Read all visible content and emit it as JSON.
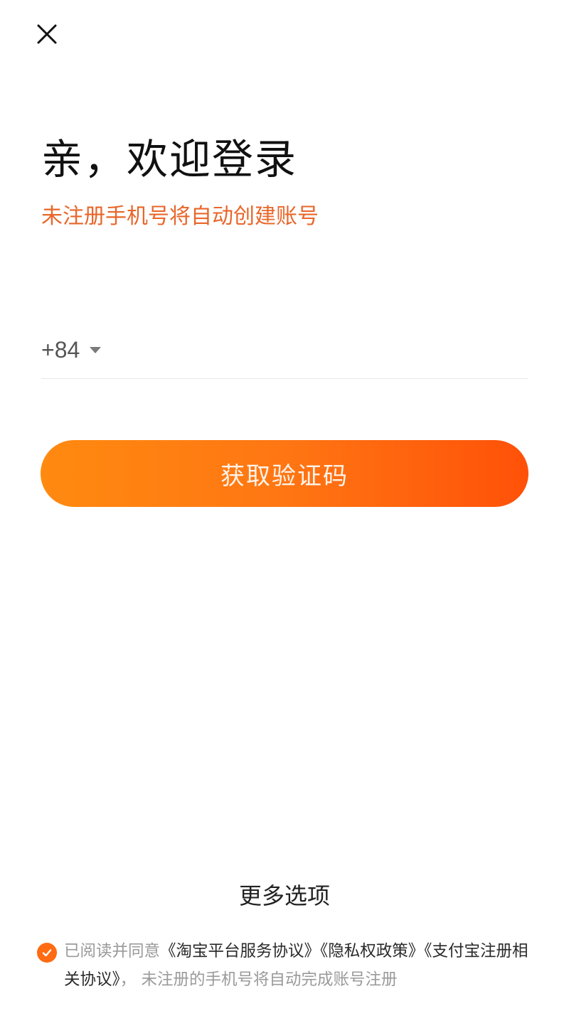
{
  "header": {
    "close_icon": "close-icon"
  },
  "title": "亲，欢迎登录",
  "subtitle": "未注册手机号将自动创建账号",
  "phone": {
    "country_code": "+84",
    "value": "",
    "placeholder": ""
  },
  "get_code_label": "获取验证码",
  "more_options_label": "更多选项",
  "agreement": {
    "checked": true,
    "prefix": "已阅读并同意",
    "links": [
      "《淘宝平台服务协议》",
      "《隐私权政策》",
      "《支付宝注册相关协议》"
    ],
    "separator": "，",
    "suffix": "未注册的手机号将自动完成账号注册"
  },
  "colors": {
    "accent": "#ff6b12",
    "subtitle": "#e8662a",
    "button_gradient_start": "#ff8a10",
    "button_gradient_end": "#ff5108"
  }
}
